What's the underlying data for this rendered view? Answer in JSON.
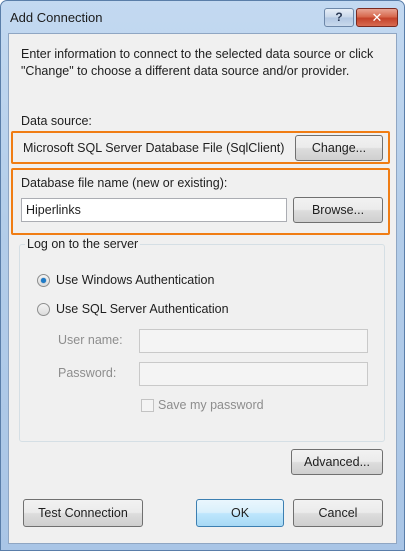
{
  "window": {
    "title": "Add Connection",
    "help_label": "?",
    "close_label": "✕"
  },
  "intro_text": "Enter information to connect to the selected data source or click \"Change\" to choose a different data source and/or provider.",
  "data_source": {
    "label": "Data source:",
    "value": "Microsoft SQL Server Database File (SqlClient)",
    "change_button": "Change..."
  },
  "database_file": {
    "label": "Database file name (new or existing):",
    "value": "Hiperlinks",
    "browse_button": "Browse..."
  },
  "logon": {
    "group_title": "Log on to the server",
    "windows_auth_label": "Use Windows Authentication",
    "windows_auth_checked": true,
    "sql_auth_label": "Use SQL Server Authentication",
    "sql_auth_checked": false,
    "username_label": "User name:",
    "username_value": "",
    "password_label": "Password:",
    "password_value": "",
    "save_password_label": "Save my password",
    "save_password_checked": false
  },
  "buttons": {
    "advanced": "Advanced...",
    "test_connection": "Test Connection",
    "ok": "OK",
    "cancel": "Cancel"
  },
  "colors": {
    "highlight": "#f07d14",
    "title_bar": "#b3cde9",
    "close_button": "#c4422a"
  }
}
